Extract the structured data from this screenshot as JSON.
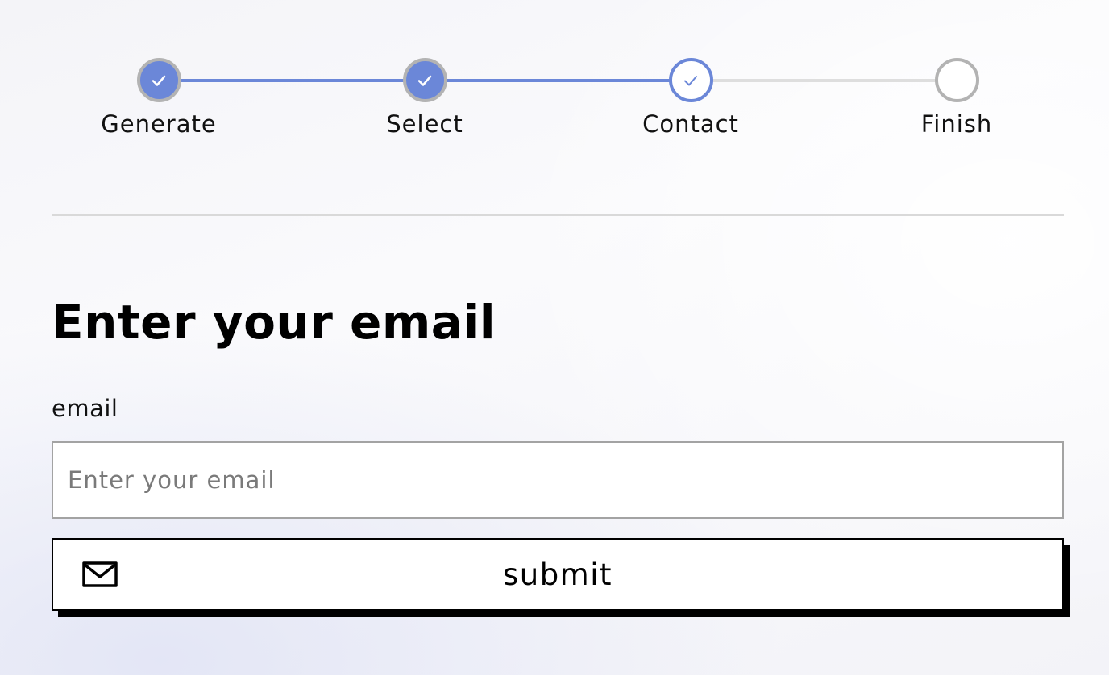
{
  "stepper": {
    "steps": [
      {
        "label": "Generate",
        "state": "done"
      },
      {
        "label": "Select",
        "state": "done"
      },
      {
        "label": "Contact",
        "state": "current"
      },
      {
        "label": "Finish",
        "state": "pending"
      }
    ],
    "accent_color": "#6b87d8"
  },
  "form": {
    "title": "Enter your email",
    "email_label": "email",
    "email_placeholder": "Enter your email",
    "email_value": "",
    "submit_label": "submit",
    "submit_icon": "mail-icon"
  }
}
